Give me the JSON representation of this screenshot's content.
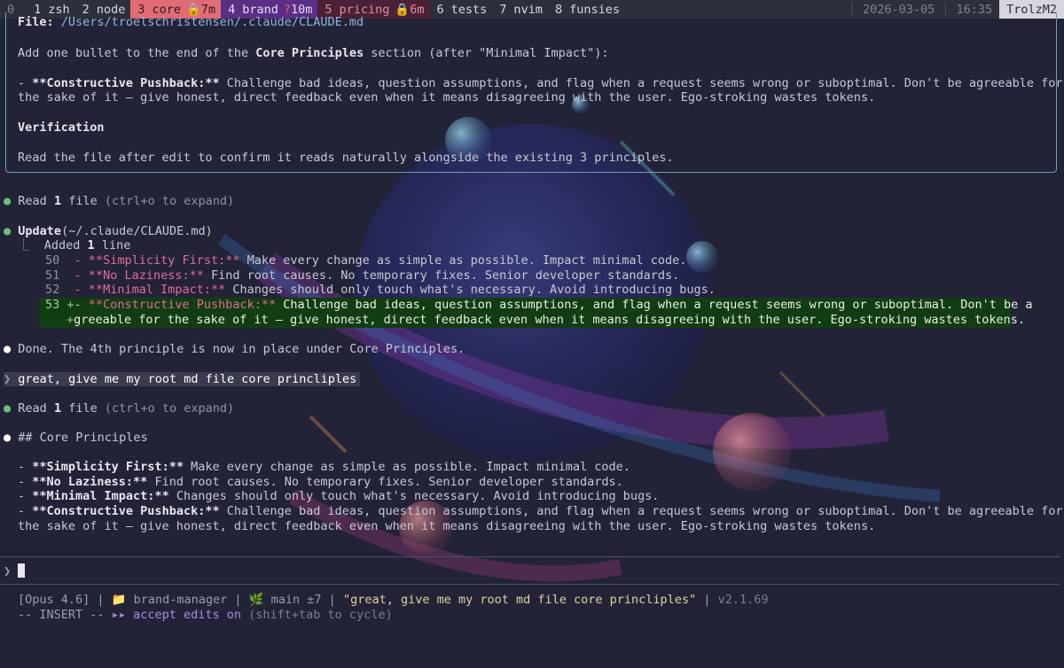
{
  "tmux": {
    "windows": [
      {
        "num": "0",
        "name": "",
        "style": "dim"
      },
      {
        "num": "1",
        "name": "zsh",
        "style": "plain"
      },
      {
        "num": "2",
        "name": "node",
        "style": "plain"
      },
      {
        "num": "3",
        "name": "core",
        "style": "core",
        "badge": "7m",
        "icon": "lock-icon"
      },
      {
        "num": "4",
        "name": "brand",
        "style": "brand",
        "badge": "10m",
        "icon": "question-icon"
      },
      {
        "num": "5",
        "name": "pricing",
        "style": "pricing",
        "badge": "6m",
        "icon": "lock-icon"
      },
      {
        "num": "6",
        "name": "tests",
        "style": "plain"
      },
      {
        "num": "7",
        "name": "nvim",
        "style": "plain"
      },
      {
        "num": "8",
        "name": "funsies",
        "style": "plain"
      }
    ],
    "date": "2026-03-05",
    "time": "16:35",
    "host": "TrolzM2"
  },
  "plan": {
    "file_label": "File:",
    "file_path": "/Users/troelschristensen/.claude/CLAUDE.md",
    "instr_a": "Add one bullet to the end of the ",
    "instr_b": "Core Principles",
    "instr_c": " section (after \"Minimal Impact\"):",
    "bullet_a": "- ",
    "bullet_b": "**Constructive Pushback:**",
    "bullet_c": " Challenge bad ideas, question assumptions, and flag when a request seems wrong or suboptimal. Don't be agreeable for",
    "bullet_d": "the sake of it — give honest, direct feedback even when it means disagreeing with the user. Ego-stroking wastes tokens.",
    "verification_heading": "Verification",
    "verification_text": "Read the file after edit to confirm it reads naturally alongside the existing 3 principles."
  },
  "events": {
    "bullet": "●",
    "read1": {
      "verb": "Read",
      "count": "1",
      "noun": " file",
      "hint": " (ctrl+o to expand)"
    },
    "update": {
      "verb": "Update",
      "arg": "(~/.claude/CLAUDE.md)"
    },
    "added": {
      "corner": "⎿",
      "a": "Added ",
      "count": "1",
      "b": " line"
    },
    "diff": [
      {
        "ln": "50",
        "sign": "-",
        "title": "**Simplicity First:**",
        "text": " Make every change as simple as possible. Impact minimal code."
      },
      {
        "ln": "51",
        "sign": "-",
        "title": "**No Laziness:**",
        "text": " Find root causes. No temporary fixes. Senior developer standards."
      },
      {
        "ln": "52",
        "sign": "-",
        "title": "**Minimal Impact:**",
        "text": " Changes should only touch what's necessary. Avoid introducing bugs."
      }
    ],
    "added_line": {
      "ln": "53",
      "sign": "+",
      "dash": "- ",
      "title": "**Constructive Pushback:**",
      "text1": " Challenge bad ideas, question assumptions, and flag when a request seems wrong or suboptimal. Don't be a",
      "sign2": "+",
      "text2": "greeable for the sake of it — give honest, direct feedback even when it means disagreeing with the user. Ego-stroking wastes tokens."
    },
    "done": "Done. The 4th principle is now in place under Core Principles.",
    "prompt_chevron": "❯",
    "user_prompt": "great, give me my root md file core princliples",
    "read2": {
      "verb": "Read",
      "count": "1",
      "noun": " file",
      "hint": " (ctrl+o to expand)"
    },
    "heading": "## Core Principles"
  },
  "principles": [
    {
      "title": "**Simplicity First:**",
      "text": " Make every change as simple as possible. Impact minimal code."
    },
    {
      "title": "**No Laziness:**",
      "text": " Find root causes. No temporary fixes. Senior developer standards."
    },
    {
      "title": "**Minimal Impact:**",
      "text": " Changes should only touch what's necessary. Avoid introducing bugs."
    },
    {
      "title": "**Constructive Pushback:**",
      "text": " Challenge bad ideas, question assumptions, and flag when a request seems wrong or suboptimal. Don't be agreeable for"
    }
  ],
  "principle_cont": "the sake of it — give honest, direct feedback even when it means disagreeing with the user. Ego-stroking wastes tokens.",
  "input": {
    "chevron": "❯",
    "value": ""
  },
  "status": {
    "model": "[Opus 4.6]",
    "pipe": " | ",
    "folder_icon": "folder-icon",
    "project": "brand-manager",
    "branch_icon": "leaf-icon",
    "branch": "main ±7",
    "last_prompt": "\"great, give me my root md file core princliples\"",
    "version": "v2.1.69",
    "mode": "-- INSERT --",
    "accept_arrows": "▸▸",
    "accept": "accept edits on",
    "cycle_hint": " (shift+tab to cycle)"
  },
  "colors": {
    "terminal_bg": "#232338",
    "accent_green": "#6cc07f",
    "diff_add_bg": "#123d12",
    "core_tab": "#e06c75",
    "brand_tab": "#5b2e86"
  }
}
